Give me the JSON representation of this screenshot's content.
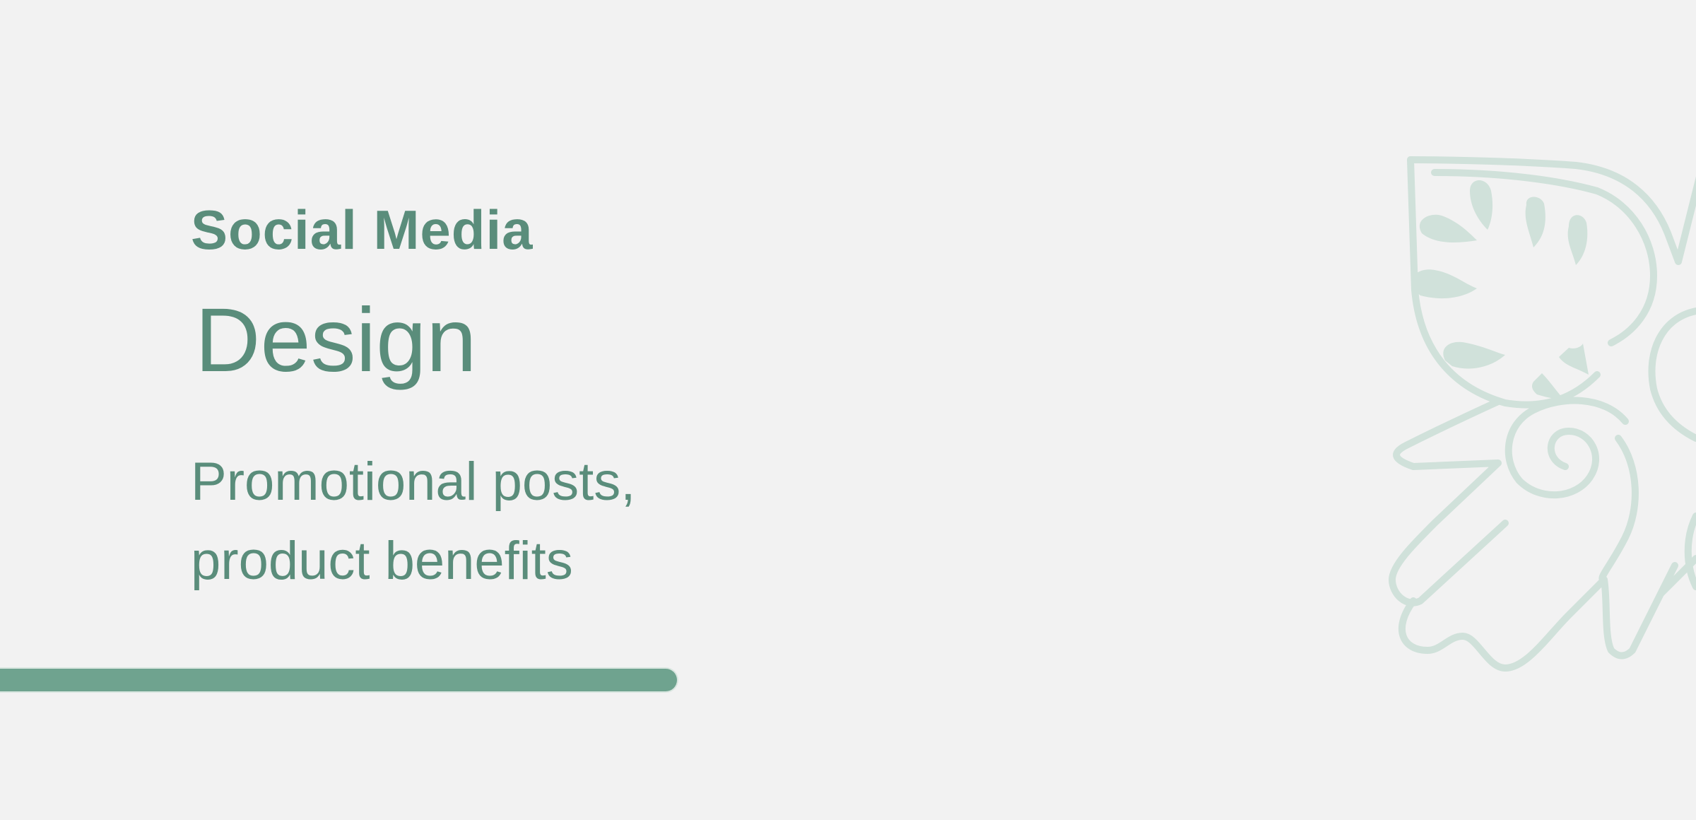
{
  "banner": {
    "title_line1": "Social Media",
    "title_line2": "Design",
    "subtitle_line1": "Promotional posts,",
    "subtitle_line2": "product benefits"
  },
  "colors": {
    "background": "#f2f2f2",
    "text": "#5a8d7b",
    "accent_bar": "#6fa38f",
    "ornament": "#d0e1da"
  },
  "ornament": {
    "icon": "decorative-hamsa-hand-icon"
  }
}
